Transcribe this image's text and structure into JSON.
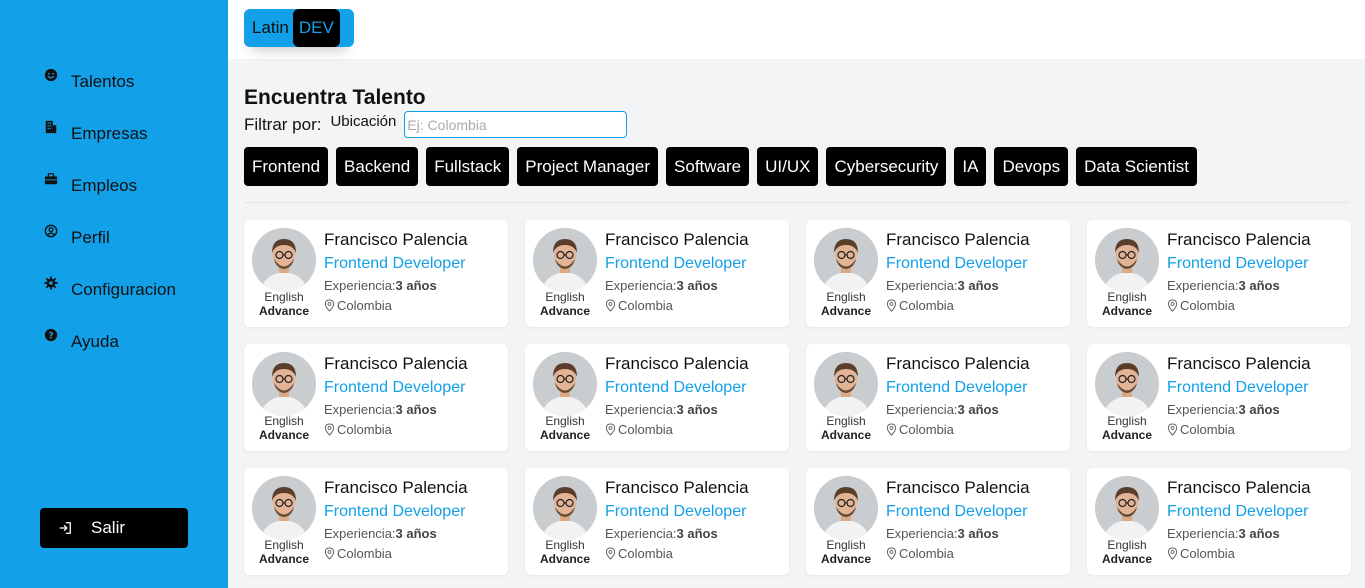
{
  "brand": {
    "part1": "Latin",
    "part2": "DEV"
  },
  "sidebar": {
    "items": [
      {
        "label": "Talentos",
        "icon": "smile-icon"
      },
      {
        "label": "Empresas",
        "icon": "building-icon"
      },
      {
        "label": "Empleos",
        "icon": "briefcase-icon"
      },
      {
        "label": "Perfil",
        "icon": "user-circle-icon"
      },
      {
        "label": "Configuracion",
        "icon": "gear-icon"
      },
      {
        "label": "Ayuda",
        "icon": "question-icon"
      }
    ],
    "logout_label": "Salir"
  },
  "main": {
    "title": "Encuentra Talento",
    "filter_label": "Filtrar por:",
    "location_label": "Ubicación",
    "location_placeholder": "Ej: Colombia",
    "categories": [
      "Frontend",
      "Backend",
      "Fullstack",
      "Project Manager",
      "Software",
      "UI/UX",
      "Cybersecurity",
      "IA",
      "Devops",
      "Data Scientist"
    ]
  },
  "talents": [
    {
      "name": "Francisco Palencia",
      "role": "Frontend Developer",
      "experience_label": "Experiencia:",
      "experience": "3 años",
      "location": "Colombia",
      "language": "English",
      "level": "Advance"
    },
    {
      "name": "Francisco Palencia",
      "role": "Frontend Developer",
      "experience_label": "Experiencia:",
      "experience": "3 años",
      "location": "Colombia",
      "language": "English",
      "level": "Advance"
    },
    {
      "name": "Francisco Palencia",
      "role": "Frontend Developer",
      "experience_label": "Experiencia:",
      "experience": "3 años",
      "location": "Colombia",
      "language": "English",
      "level": "Advance"
    },
    {
      "name": "Francisco Palencia",
      "role": "Frontend Developer",
      "experience_label": "Experiencia:",
      "experience": "3 años",
      "location": "Colombia",
      "language": "English",
      "level": "Advance"
    },
    {
      "name": "Francisco Palencia",
      "role": "Frontend Developer",
      "experience_label": "Experiencia:",
      "experience": "3 años",
      "location": "Colombia",
      "language": "English",
      "level": "Advance"
    },
    {
      "name": "Francisco Palencia",
      "role": "Frontend Developer",
      "experience_label": "Experiencia:",
      "experience": "3 años",
      "location": "Colombia",
      "language": "English",
      "level": "Advance"
    },
    {
      "name": "Francisco Palencia",
      "role": "Frontend Developer",
      "experience_label": "Experiencia:",
      "experience": "3 años",
      "location": "Colombia",
      "language": "English",
      "level": "Advance"
    },
    {
      "name": "Francisco Palencia",
      "role": "Frontend Developer",
      "experience_label": "Experiencia:",
      "experience": "3 años",
      "location": "Colombia",
      "language": "English",
      "level": "Advance"
    },
    {
      "name": "Francisco Palencia",
      "role": "Frontend Developer",
      "experience_label": "Experiencia:",
      "experience": "3 años",
      "location": "Colombia",
      "language": "English",
      "level": "Advance"
    },
    {
      "name": "Francisco Palencia",
      "role": "Frontend Developer",
      "experience_label": "Experiencia:",
      "experience": "3 años",
      "location": "Colombia",
      "language": "English",
      "level": "Advance"
    },
    {
      "name": "Francisco Palencia",
      "role": "Frontend Developer",
      "experience_label": "Experiencia:",
      "experience": "3 años",
      "location": "Colombia",
      "language": "English",
      "level": "Advance"
    },
    {
      "name": "Francisco Palencia",
      "role": "Frontend Developer",
      "experience_label": "Experiencia:",
      "experience": "3 años",
      "location": "Colombia",
      "language": "English",
      "level": "Advance"
    }
  ],
  "colors": {
    "accent": "#12a0e8",
    "chip_bg": "#000000",
    "page_bg": "#f3f4f6"
  }
}
